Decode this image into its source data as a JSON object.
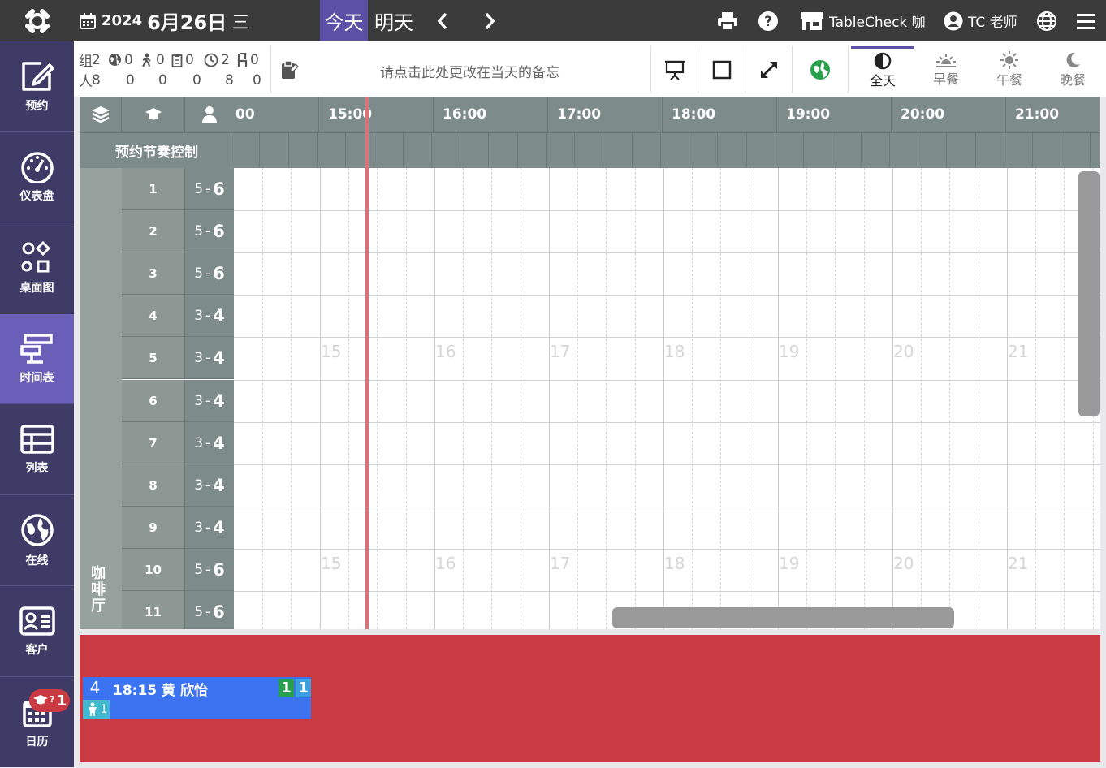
{
  "topbar": {
    "year": "2024",
    "month_day": "6月26日",
    "weekday": "三",
    "today_label": "今天",
    "tomorrow_label": "明天",
    "shop_name": "TableCheck 咖",
    "user_name": "TC 老师"
  },
  "sidebar": {
    "items": [
      {
        "label": "预约",
        "icon": "edit-icon"
      },
      {
        "label": "仪表盘",
        "icon": "dashboard-icon"
      },
      {
        "label": "桌面图",
        "icon": "shapes-icon"
      },
      {
        "label": "时间表",
        "icon": "timetable-icon"
      },
      {
        "label": "列表",
        "icon": "table-icon"
      },
      {
        "label": "在线",
        "icon": "globe-icon"
      },
      {
        "label": "客户",
        "icon": "customer-card-icon"
      },
      {
        "label": "日历",
        "icon": "calendar-icon"
      }
    ],
    "calendar_badge": "1",
    "calendar_badge_prefix": "?"
  },
  "stats": {
    "groups_label": "组",
    "people_label": "人",
    "groups": [
      "2",
      "0",
      "0",
      "0",
      "2",
      "0"
    ],
    "people": [
      "8",
      "0",
      "0",
      "0",
      "8",
      "0"
    ]
  },
  "memo": {
    "placeholder": "请点击此处更改在当天的备忘"
  },
  "meals": [
    {
      "label": "全天",
      "icon": "half-circle-icon"
    },
    {
      "label": "早餐",
      "icon": "sunrise-icon"
    },
    {
      "label": "午餐",
      "icon": "sun-icon"
    },
    {
      "label": "晚餐",
      "icon": "moon-icon"
    }
  ],
  "timeline": {
    "hours": [
      "00",
      "15:00",
      "16:00",
      "17:00",
      "18:00",
      "19:00",
      "20:00",
      "21:00"
    ],
    "watermarks": [
      "15",
      "16",
      "17",
      "18",
      "19",
      "20",
      "21"
    ],
    "pace_label": "预约节奏控制",
    "section_label": "咖啡厅"
  },
  "tables": [
    {
      "num": "1",
      "min": "5",
      "max": "6"
    },
    {
      "num": "2",
      "min": "5",
      "max": "6"
    },
    {
      "num": "3",
      "min": "5",
      "max": "6"
    },
    {
      "num": "4",
      "min": "3",
      "max": "4"
    },
    {
      "num": "5",
      "min": "3",
      "max": "4"
    },
    {
      "num": "6",
      "min": "3",
      "max": "4"
    },
    {
      "num": "7",
      "min": "3",
      "max": "4"
    },
    {
      "num": "8",
      "min": "3",
      "max": "4"
    },
    {
      "num": "9",
      "min": "3",
      "max": "4"
    },
    {
      "num": "10",
      "min": "5",
      "max": "6"
    },
    {
      "num": "11",
      "min": "5",
      "max": "6"
    }
  ],
  "unassigned": {
    "party": "4",
    "time_name": "18:15 黄 欣怡",
    "badge_green": "1",
    "badge_blue": "1",
    "kids": "1"
  }
}
